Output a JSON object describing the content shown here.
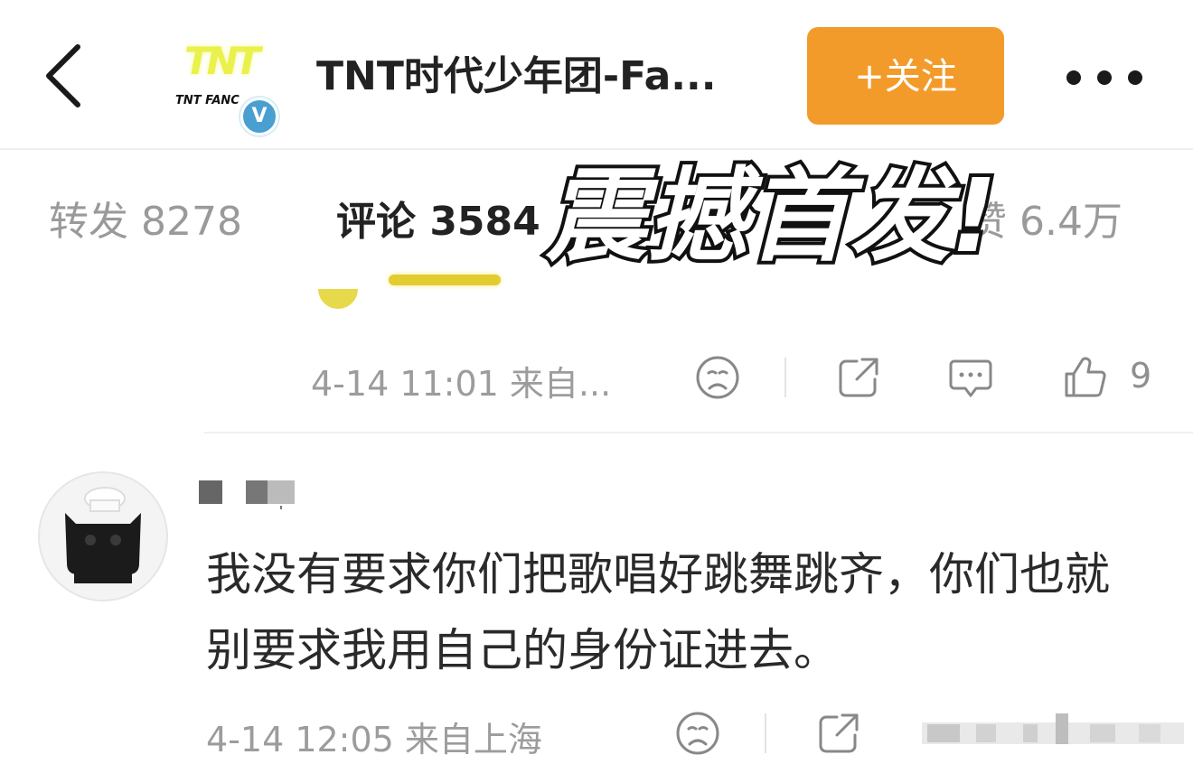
{
  "header": {
    "title": "TNT时代少年团-Fa...",
    "follow_label": "+关注",
    "logo_mark": "TNT",
    "logo_text": "TNT FANC",
    "verified_badge": "V",
    "accent_color": "#f39b2a"
  },
  "tabs": [
    {
      "label": "转发 8278",
      "active": false
    },
    {
      "label": "评论 3584",
      "active": true
    },
    {
      "label": "赞 6.4万",
      "active": false
    }
  ],
  "overlay": {
    "text": "震撼首发!"
  },
  "comment_1": {
    "meta_time": "4-14 11:01 来自...",
    "like_count": "9"
  },
  "comment_2": {
    "text": "我没有要求你们把歌唱好跳舞跳齐，你们也就别要求我用自己的身份证进去。",
    "meta_time": "4-14 12:05 来自上海"
  },
  "icons": [
    "back-icon",
    "more-icon",
    "sad-face-icon",
    "share-icon",
    "comment-icon",
    "thumbs-up-icon"
  ]
}
